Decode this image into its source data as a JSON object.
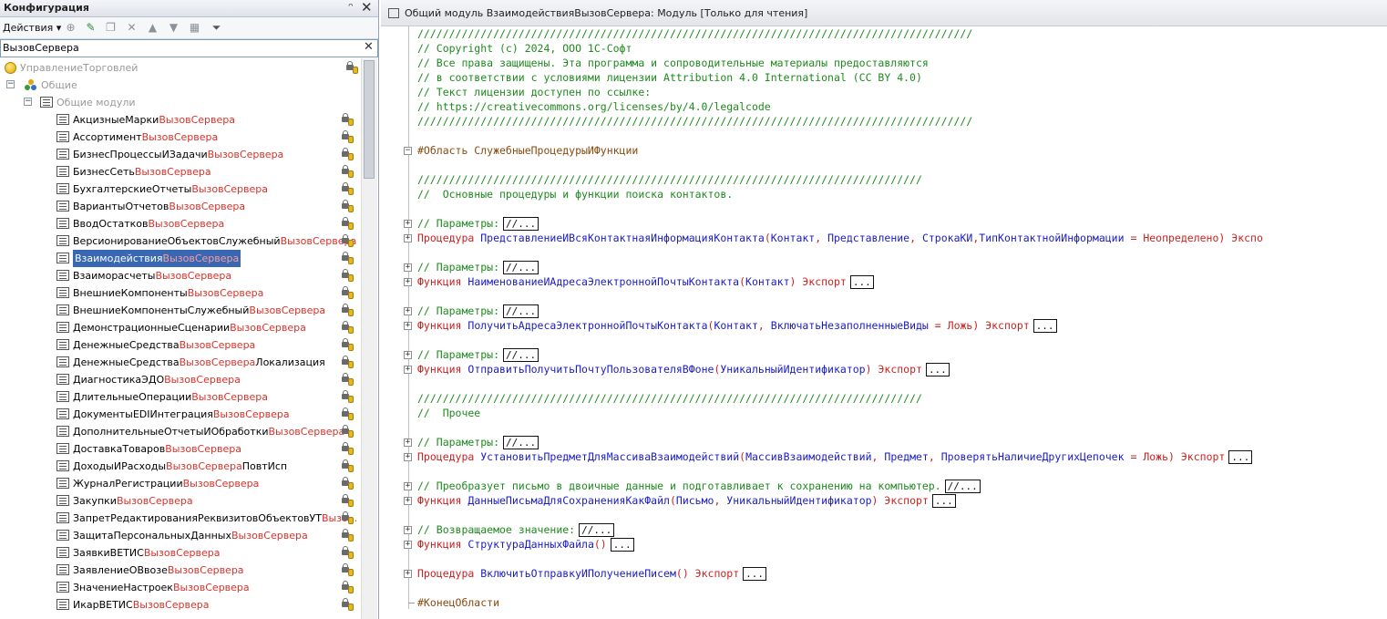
{
  "config_panel": {
    "title": "Конфигурация",
    "pin_glyph": "ᴖ",
    "close_glyph": "✕",
    "actions_label": "Действия ▾",
    "toolbar_icons": [
      "add-icon",
      "edit-pencil-icon",
      "copy-icon",
      "delete-icon",
      "move-up-icon",
      "move-down-icon",
      "sort-icon",
      "filter-icon"
    ],
    "search_value": "ВызовСервера",
    "search_clear_glyph": "✕"
  },
  "tree": {
    "root": {
      "label": "УправлениеТорговлей"
    },
    "common": {
      "label": "Общие"
    },
    "common_modules": {
      "label": "Общие модули"
    },
    "modules": [
      {
        "pre": "АкцизныеМарки",
        "hl": "ВызовСервера",
        "post": ""
      },
      {
        "pre": "Ассортимент",
        "hl": "ВызовСервера",
        "post": ""
      },
      {
        "pre": "БизнесПроцессыИЗадачи",
        "hl": "ВызовСервера",
        "post": ""
      },
      {
        "pre": "БизнесСеть",
        "hl": "ВызовСервера",
        "post": ""
      },
      {
        "pre": "БухгалтерскиеОтчеты",
        "hl": "ВызовСервера",
        "post": ""
      },
      {
        "pre": "ВариантыОтчетов",
        "hl": "ВызовСервера",
        "post": ""
      },
      {
        "pre": "ВводОстатков",
        "hl": "ВызовСервера",
        "post": ""
      },
      {
        "pre": "ВерсионированиеОбъектовСлужебный",
        "hl": "ВызовСервера",
        "post": ""
      },
      {
        "pre": "Взаимодействия",
        "hl": "ВызовСервера",
        "post": "",
        "selected": true
      },
      {
        "pre": "Взаиморасчеты",
        "hl": "ВызовСервера",
        "post": ""
      },
      {
        "pre": "ВнешниеКомпоненты",
        "hl": "ВызовСервера",
        "post": ""
      },
      {
        "pre": "ВнешниеКомпонентыСлужебный",
        "hl": "ВызовСервера",
        "post": ""
      },
      {
        "pre": "ДемонстрационныеСценарии",
        "hl": "ВызовСервера",
        "post": ""
      },
      {
        "pre": "ДенежныеСредства",
        "hl": "ВызовСервера",
        "post": ""
      },
      {
        "pre": "ДенежныеСредства",
        "hl": "ВызовСервера",
        "post": "Локализация"
      },
      {
        "pre": "ДиагностикаЭДО",
        "hl": "ВызовСервера",
        "post": ""
      },
      {
        "pre": "ДлительныеОперации",
        "hl": "ВызовСервера",
        "post": ""
      },
      {
        "pre": "ДокументыEDIИнтеграция",
        "hl": "ВызовСервера",
        "post": ""
      },
      {
        "pre": "ДополнительныеОтчетыИОбработки",
        "hl": "ВызовСервера",
        "post": ""
      },
      {
        "pre": "ДоставкаТоваров",
        "hl": "ВызовСервера",
        "post": ""
      },
      {
        "pre": "ДоходыИРасходы",
        "hl": "ВызовСервера",
        "post": "ПовтИсп"
      },
      {
        "pre": "ЖурналРегистрации",
        "hl": "ВызовСервера",
        "post": ""
      },
      {
        "pre": "Закупки",
        "hl": "ВызовСервера",
        "post": ""
      },
      {
        "pre": "ЗапретРедактированияРеквизитовОбъектовУТ",
        "hl": "Вызо...",
        "post": ""
      },
      {
        "pre": "ЗащитаПерсональныхДанных",
        "hl": "ВызовСервера",
        "post": ""
      },
      {
        "pre": "ЗаявкиВЕТИС",
        "hl": "ВызовСервера",
        "post": ""
      },
      {
        "pre": "ЗаявлениеОВвозе",
        "hl": "ВызовСервера",
        "post": ""
      },
      {
        "pre": "ЗначениеНастроек",
        "hl": "ВызовСервера",
        "post": ""
      },
      {
        "pre": "ИкарВЕТИС",
        "hl": "ВызовСервера",
        "post": ""
      }
    ]
  },
  "editor": {
    "title": "Общий модуль ВзаимодействияВызовСервера: Модуль [Только для чтения]",
    "lines": [
      {
        "fold": "",
        "segs": [
          {
            "t": "////////////////////////////////////////////////////////////////////////////////////////",
            "c": "com"
          }
        ]
      },
      {
        "fold": "",
        "segs": [
          {
            "t": "// Copyright (c) 2024, ООО 1С-Софт",
            "c": "com"
          }
        ]
      },
      {
        "fold": "",
        "segs": [
          {
            "t": "// Все права защищены. Эта программа и сопроводительные материалы предоставляются",
            "c": "com"
          }
        ]
      },
      {
        "fold": "",
        "segs": [
          {
            "t": "// в соответствии с условиями лицензии Attribution 4.0 International (CC BY 4.0)",
            "c": "com"
          }
        ]
      },
      {
        "fold": "",
        "segs": [
          {
            "t": "// Текст лицензии доступен по ссылке:",
            "c": "com"
          }
        ]
      },
      {
        "fold": "",
        "segs": [
          {
            "t": "// https://creativecommons.org/licenses/by/4.0/legalcode",
            "c": "com"
          }
        ]
      },
      {
        "fold": "",
        "segs": [
          {
            "t": "////////////////////////////////////////////////////////////////////////////////////////",
            "c": "com"
          }
        ]
      },
      {
        "fold": "",
        "segs": []
      },
      {
        "fold": "minus",
        "segs": [
          {
            "t": "#Область СлужебныеПроцедурыИФункции",
            "c": "pre"
          }
        ]
      },
      {
        "fold": "",
        "segs": []
      },
      {
        "fold": "",
        "segs": [
          {
            "t": "////////////////////////////////////////////////////////////////////////////////",
            "c": "com"
          }
        ]
      },
      {
        "fold": "",
        "segs": [
          {
            "t": "//  Основные процедуры и функции поиска контактов.",
            "c": "com"
          }
        ]
      },
      {
        "fold": "",
        "segs": []
      },
      {
        "fold": "plus",
        "segs": [
          {
            "t": "// Параметры:",
            "c": "com"
          }
        ],
        "box": "//..."
      },
      {
        "fold": "plus",
        "segs": [
          {
            "t": "Процедура ",
            "c": "kw"
          },
          {
            "t": "ПредставлениеИВсяКонтактнаяИнформацияКонтакта",
            "c": "id"
          },
          {
            "t": "(",
            "c": "op"
          },
          {
            "t": "Контакт",
            "c": "id"
          },
          {
            "t": ", ",
            "c": "op"
          },
          {
            "t": "Представление",
            "c": "id"
          },
          {
            "t": ", ",
            "c": "op"
          },
          {
            "t": "СтрокаКИ",
            "c": "id"
          },
          {
            "t": ",",
            "c": "op"
          },
          {
            "t": "ТипКонтактнойИнформации",
            "c": "id"
          },
          {
            "t": " = ",
            "c": "op"
          },
          {
            "t": "Неопределено",
            "c": "kw"
          },
          {
            "t": ") ",
            "c": "op"
          },
          {
            "t": "Экспо",
            "c": "kw"
          }
        ]
      },
      {
        "fold": "",
        "segs": []
      },
      {
        "fold": "plus",
        "segs": [
          {
            "t": "// Параметры:",
            "c": "com"
          }
        ],
        "box": "//..."
      },
      {
        "fold": "plus",
        "segs": [
          {
            "t": "Функция ",
            "c": "kw"
          },
          {
            "t": "НаименованиеИАдресаЭлектроннойПочтыКонтакта",
            "c": "id"
          },
          {
            "t": "(",
            "c": "op"
          },
          {
            "t": "Контакт",
            "c": "id"
          },
          {
            "t": ") ",
            "c": "op"
          },
          {
            "t": "Экспорт",
            "c": "kw"
          }
        ],
        "box": "..."
      },
      {
        "fold": "",
        "segs": []
      },
      {
        "fold": "plus",
        "segs": [
          {
            "t": "// Параметры:",
            "c": "com"
          }
        ],
        "box": "//..."
      },
      {
        "fold": "plus",
        "segs": [
          {
            "t": "Функция ",
            "c": "kw"
          },
          {
            "t": "ПолучитьАдресаЭлектроннойПочтыКонтакта",
            "c": "id"
          },
          {
            "t": "(",
            "c": "op"
          },
          {
            "t": "Контакт",
            "c": "id"
          },
          {
            "t": ", ",
            "c": "op"
          },
          {
            "t": "ВключатьНезаполненныеВиды",
            "c": "id"
          },
          {
            "t": " = ",
            "c": "op"
          },
          {
            "t": "Ложь",
            "c": "kw"
          },
          {
            "t": ") ",
            "c": "op"
          },
          {
            "t": "Экспорт",
            "c": "kw"
          }
        ],
        "box": "..."
      },
      {
        "fold": "",
        "segs": []
      },
      {
        "fold": "plus",
        "segs": [
          {
            "t": "// Параметры:",
            "c": "com"
          }
        ],
        "box": "//..."
      },
      {
        "fold": "plus",
        "segs": [
          {
            "t": "Функция ",
            "c": "kw"
          },
          {
            "t": "ОтправитьПолучитьПочтуПользователяВФоне",
            "c": "id"
          },
          {
            "t": "(",
            "c": "op"
          },
          {
            "t": "УникальныйИдентификатор",
            "c": "id"
          },
          {
            "t": ") ",
            "c": "op"
          },
          {
            "t": "Экспорт",
            "c": "kw"
          }
        ],
        "box": "..."
      },
      {
        "fold": "",
        "segs": []
      },
      {
        "fold": "",
        "segs": [
          {
            "t": "////////////////////////////////////////////////////////////////////////////////",
            "c": "com"
          }
        ]
      },
      {
        "fold": "",
        "segs": [
          {
            "t": "//  Прочее",
            "c": "com"
          }
        ]
      },
      {
        "fold": "",
        "segs": []
      },
      {
        "fold": "plus",
        "segs": [
          {
            "t": "// Параметры:",
            "c": "com"
          }
        ],
        "box": "//..."
      },
      {
        "fold": "plus",
        "segs": [
          {
            "t": "Процедура ",
            "c": "kw"
          },
          {
            "t": "УстановитьПредметДляМассиваВзаимодействий",
            "c": "id"
          },
          {
            "t": "(",
            "c": "op"
          },
          {
            "t": "МассивВзаимодействий",
            "c": "id"
          },
          {
            "t": ", ",
            "c": "op"
          },
          {
            "t": "Предмет",
            "c": "id"
          },
          {
            "t": ", ",
            "c": "op"
          },
          {
            "t": "ПроверятьНаличиеДругихЦепочек",
            "c": "id"
          },
          {
            "t": " = ",
            "c": "op"
          },
          {
            "t": "Ложь",
            "c": "kw"
          },
          {
            "t": ") ",
            "c": "op"
          },
          {
            "t": "Экспорт",
            "c": "kw"
          }
        ],
        "box": "..."
      },
      {
        "fold": "",
        "segs": []
      },
      {
        "fold": "plus",
        "segs": [
          {
            "t": "// Преобразует письмо в двоичные данные и подготавливает к сохранению на компьютер.",
            "c": "com"
          }
        ],
        "box": "//..."
      },
      {
        "fold": "plus",
        "segs": [
          {
            "t": "Функция ",
            "c": "kw"
          },
          {
            "t": "ДанныеПисьмаДляСохраненияКакФайл",
            "c": "id"
          },
          {
            "t": "(",
            "c": "op"
          },
          {
            "t": "Письмо",
            "c": "id"
          },
          {
            "t": ", ",
            "c": "op"
          },
          {
            "t": "УникальныйИдентификатор",
            "c": "id"
          },
          {
            "t": ") ",
            "c": "op"
          },
          {
            "t": "Экспорт",
            "c": "kw"
          }
        ],
        "box": "..."
      },
      {
        "fold": "",
        "segs": []
      },
      {
        "fold": "plus",
        "segs": [
          {
            "t": "// Возвращаемое значение:",
            "c": "com"
          }
        ],
        "box": "//..."
      },
      {
        "fold": "plus",
        "segs": [
          {
            "t": "Функция ",
            "c": "kw"
          },
          {
            "t": "СтруктураДанныхФайла",
            "c": "id"
          },
          {
            "t": "()",
            "c": "op"
          }
        ],
        "box": "..."
      },
      {
        "fold": "",
        "segs": []
      },
      {
        "fold": "plus",
        "segs": [
          {
            "t": "Процедура ",
            "c": "kw"
          },
          {
            "t": "ВключитьОтправкуИПолучениеПисем",
            "c": "id"
          },
          {
            "t": "() ",
            "c": "op"
          },
          {
            "t": "Экспорт",
            "c": "kw"
          }
        ],
        "box": "..."
      },
      {
        "fold": "",
        "segs": []
      },
      {
        "fold": "end",
        "segs": [
          {
            "t": "#КонецОбласти",
            "c": "pre"
          }
        ]
      }
    ]
  },
  "colors": {
    "comment": "#1e8a1e",
    "keyword": "#cc2020",
    "identifier": "#1b1bc8",
    "preprocessor": "#8a4a10",
    "highlight": "#d9322a",
    "selection": "#3867b3"
  }
}
